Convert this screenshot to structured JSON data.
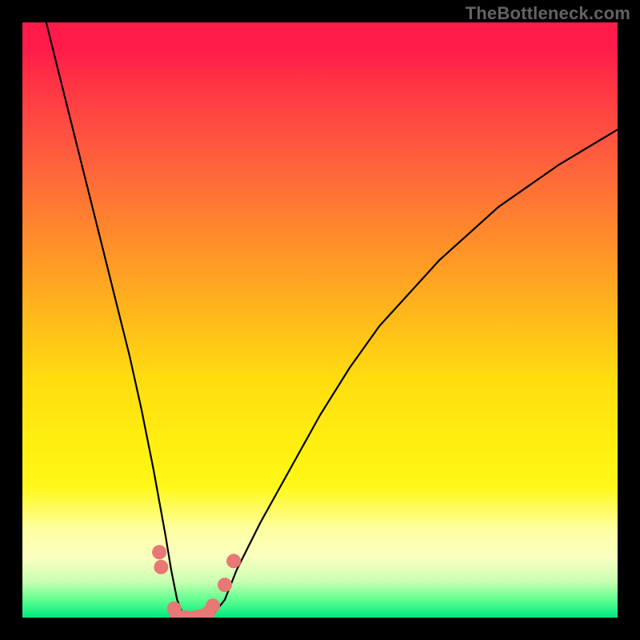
{
  "credit": "TheBottleneck.com",
  "chart_data": {
    "type": "line",
    "title": "",
    "xlabel": "",
    "ylabel": "",
    "xlim": [
      0,
      100
    ],
    "ylim": [
      0,
      100
    ],
    "series": [
      {
        "name": "bottleneck-curve",
        "x": [
          4,
          6,
          8,
          10,
          12,
          14,
          16,
          18,
          20,
          22,
          24,
          25,
          26,
          27,
          28,
          30,
          32,
          34,
          36,
          40,
          45,
          50,
          55,
          60,
          70,
          80,
          90,
          100
        ],
        "y": [
          100,
          92,
          84,
          76,
          68,
          60,
          52,
          44,
          35,
          25,
          14,
          8,
          3,
          0.5,
          0,
          0,
          0.5,
          3,
          8,
          16,
          25,
          34,
          42,
          49,
          60,
          69,
          76,
          82
        ]
      }
    ],
    "markers": {
      "name": "highlighted-points",
      "color": "#e77874",
      "points": [
        {
          "x": 23.0,
          "y": 11.0
        },
        {
          "x": 23.3,
          "y": 8.5
        },
        {
          "x": 25.5,
          "y": 1.5
        },
        {
          "x": 26.0,
          "y": 0.3
        },
        {
          "x": 27.5,
          "y": 0.0
        },
        {
          "x": 29.0,
          "y": 0.0
        },
        {
          "x": 30.0,
          "y": 0.2
        },
        {
          "x": 31.2,
          "y": 0.8
        },
        {
          "x": 32.0,
          "y": 2.0
        },
        {
          "x": 34.0,
          "y": 5.5
        },
        {
          "x": 35.5,
          "y": 9.5
        }
      ]
    }
  }
}
